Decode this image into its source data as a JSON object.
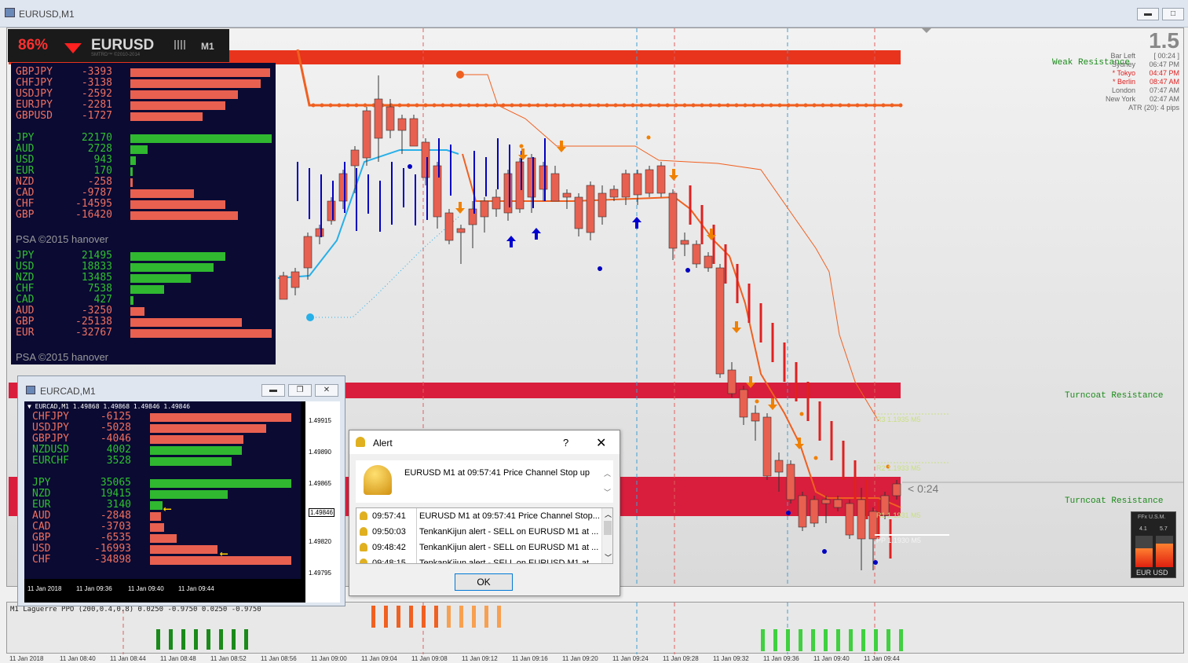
{
  "window": {
    "title": "EURUSD,M1"
  },
  "colors": {
    "red_band": "#e8341c",
    "crimson_band": "#d81e3c",
    "bull": "#30c030",
    "bear": "#e86050",
    "panel_bg": "#0a0a33"
  },
  "strength_header": {
    "percent": "86%",
    "symbol": "EURUSD",
    "tf": "M1",
    "sub": "SMTRD™ ©2010-2014"
  },
  "panel1": {
    "pairs": [
      {
        "name": "GBPJPY",
        "value": "-3393",
        "pct": 0.99,
        "dir": "neg"
      },
      {
        "name": "CHFJPY",
        "value": "-3138",
        "pct": 0.92,
        "dir": "neg"
      },
      {
        "name": "USDJPY",
        "value": "-2592",
        "pct": 0.76,
        "dir": "neg"
      },
      {
        "name": "EURJPY",
        "value": "-2281",
        "pct": 0.67,
        "dir": "neg"
      },
      {
        "name": "GBPUSD",
        "value": "-1727",
        "pct": 0.51,
        "dir": "neg"
      }
    ],
    "currencies": [
      {
        "name": "JPY",
        "value": "22170",
        "pct": 1.0,
        "dir": "pos"
      },
      {
        "name": "AUD",
        "value": "2728",
        "pct": 0.12,
        "dir": "pos"
      },
      {
        "name": "USD",
        "value": "943",
        "pct": 0.04,
        "dir": "pos"
      },
      {
        "name": "EUR",
        "value": "170",
        "pct": 0.01,
        "dir": "pos"
      },
      {
        "name": "NZD",
        "value": "-258",
        "pct": 0.015,
        "dir": "neg"
      },
      {
        "name": "CAD",
        "value": "-9787",
        "pct": 0.45,
        "dir": "neg"
      },
      {
        "name": "CHF",
        "value": "-14595",
        "pct": 0.67,
        "dir": "neg"
      },
      {
        "name": "GBP",
        "value": "-16420",
        "pct": 0.76,
        "dir": "neg"
      }
    ],
    "credit1": "PSA ©2015 hanover",
    "currencies2": [
      {
        "name": "JPY",
        "value": "21495",
        "pct": 0.67,
        "dir": "pos"
      },
      {
        "name": "USD",
        "value": "18833",
        "pct": 0.59,
        "dir": "pos"
      },
      {
        "name": "NZD",
        "value": "13485",
        "pct": 0.43,
        "dir": "pos"
      },
      {
        "name": "CHF",
        "value": "7538",
        "pct": 0.24,
        "dir": "pos"
      },
      {
        "name": "CAD",
        "value": "427",
        "pct": 0.02,
        "dir": "pos"
      },
      {
        "name": "AUD",
        "value": "-3250",
        "pct": 0.1,
        "dir": "neg"
      },
      {
        "name": "GBP",
        "value": "-25138",
        "pct": 0.79,
        "dir": "neg"
      },
      {
        "name": "EUR",
        "value": "-32767",
        "pct": 1.0,
        "dir": "neg"
      }
    ],
    "credit2": "PSA ©2015 hanover"
  },
  "right_info": {
    "big": "1.5",
    "rows": [
      {
        "label": "Bar Left",
        "value": "[ 00:24 ]"
      },
      {
        "label": "Sydney",
        "value": "06:47 PM"
      },
      {
        "label": "* Tokyo",
        "value": "04:47 PM"
      },
      {
        "label": "* Berlin",
        "value": "08:47 AM"
      },
      {
        "label": "London",
        "value": "07:47 AM"
      },
      {
        "label": "New York",
        "value": "02:47 AM"
      }
    ],
    "atr": "ATR (20): 4 pips"
  },
  "labels": {
    "weak_resistance": "Weak Resistance",
    "turncoat1": "Turncoat Resistance",
    "turncoat2": "Turncoat Resistance",
    "r3": "R3 1.1935 M5",
    "r2": "R2 1.1933 M5",
    "r1": "R1 1.1931 M5",
    "pp": "PP 1.1930 M5",
    "countdown": "< 0:24"
  },
  "ffx": {
    "title": "FFx U.S.M.",
    "v1": "4.1",
    "v2": "5.7",
    "pair": "EUR USD"
  },
  "eurcad": {
    "title": "EURCAD,M1",
    "header": "▼ EURCAD,M1  1.49868 1.49868 1.49846 1.49846",
    "pairs": [
      {
        "name": "CHFJPY",
        "value": "-6125",
        "pct": 1.0,
        "dir": "neg"
      },
      {
        "name": "USDJPY",
        "value": "-5028",
        "pct": 0.82,
        "dir": "neg"
      },
      {
        "name": "GBPJPY",
        "value": "-4046",
        "pct": 0.66,
        "dir": "neg"
      },
      {
        "name": "NZDUSD",
        "value": "4002",
        "pct": 0.65,
        "dir": "pos"
      },
      {
        "name": "EURCHF",
        "value": "3528",
        "pct": 0.58,
        "dir": "pos"
      }
    ],
    "currencies": [
      {
        "name": "JPY",
        "value": "35065",
        "pct": 1.0,
        "dir": "pos"
      },
      {
        "name": "NZD",
        "value": "19415",
        "pct": 0.55,
        "dir": "pos"
      },
      {
        "name": "EUR",
        "value": "3140",
        "pct": 0.09,
        "dir": "pos"
      },
      {
        "name": "AUD",
        "value": "-2848",
        "pct": 0.08,
        "dir": "neg"
      },
      {
        "name": "CAD",
        "value": "-3703",
        "pct": 0.1,
        "dir": "neg"
      },
      {
        "name": "GBP",
        "value": "-6535",
        "pct": 0.19,
        "dir": "neg"
      },
      {
        "name": "USD",
        "value": "-16993",
        "pct": 0.48,
        "dir": "neg"
      },
      {
        "name": "CHF",
        "value": "-34898",
        "pct": 1.0,
        "dir": "neg"
      }
    ],
    "prices": [
      "1.49915",
      "1.49890",
      "1.49865",
      "1.49846",
      "1.49820",
      "1.49795"
    ],
    "times": [
      "11 Jan 2018",
      "11 Jan 09:36",
      "11 Jan 09:40",
      "11 Jan 09:44"
    ]
  },
  "alert": {
    "title": "Alert",
    "help": "?",
    "close": "✕",
    "message": "EURUSD M1 at 09:57:41 Price Channel Stop up",
    "items": [
      {
        "time": "09:57:41",
        "text": "EURUSD M1 at 09:57:41 Price Channel Stop..."
      },
      {
        "time": "09:50:03",
        "text": "TenkanKijun alert - SELL on EURUSD M1 at ..."
      },
      {
        "time": "09:48:42",
        "text": "TenkanKijun alert - SELL on EURUSD M1 at ..."
      },
      {
        "time": "09:48:15",
        "text": "TenkanKijun alert - SELL on EURUSD M1 at ..."
      }
    ],
    "ok": "OK"
  },
  "subwindow": {
    "title": "M1 Laguerre PPO (200,0.4,0.8) 0.0250 -0.9750 0.0250 -0.9750"
  },
  "time_axis": [
    "11 Jan 2018",
    "11 Jan 08:40",
    "11 Jan 08:44",
    "11 Jan 08:48",
    "11 Jan 08:52",
    "11 Jan 08:56",
    "11 Jan 09:00",
    "11 Jan 09:04",
    "11 Jan 09:08",
    "11 Jan 09:12",
    "11 Jan 09:16",
    "11 Jan 09:20",
    "11 Jan 09:24",
    "11 Jan 09:28",
    "11 Jan 09:32",
    "11 Jan 09:36",
    "11 Jan 09:40",
    "11 Jan 09:44"
  ]
}
